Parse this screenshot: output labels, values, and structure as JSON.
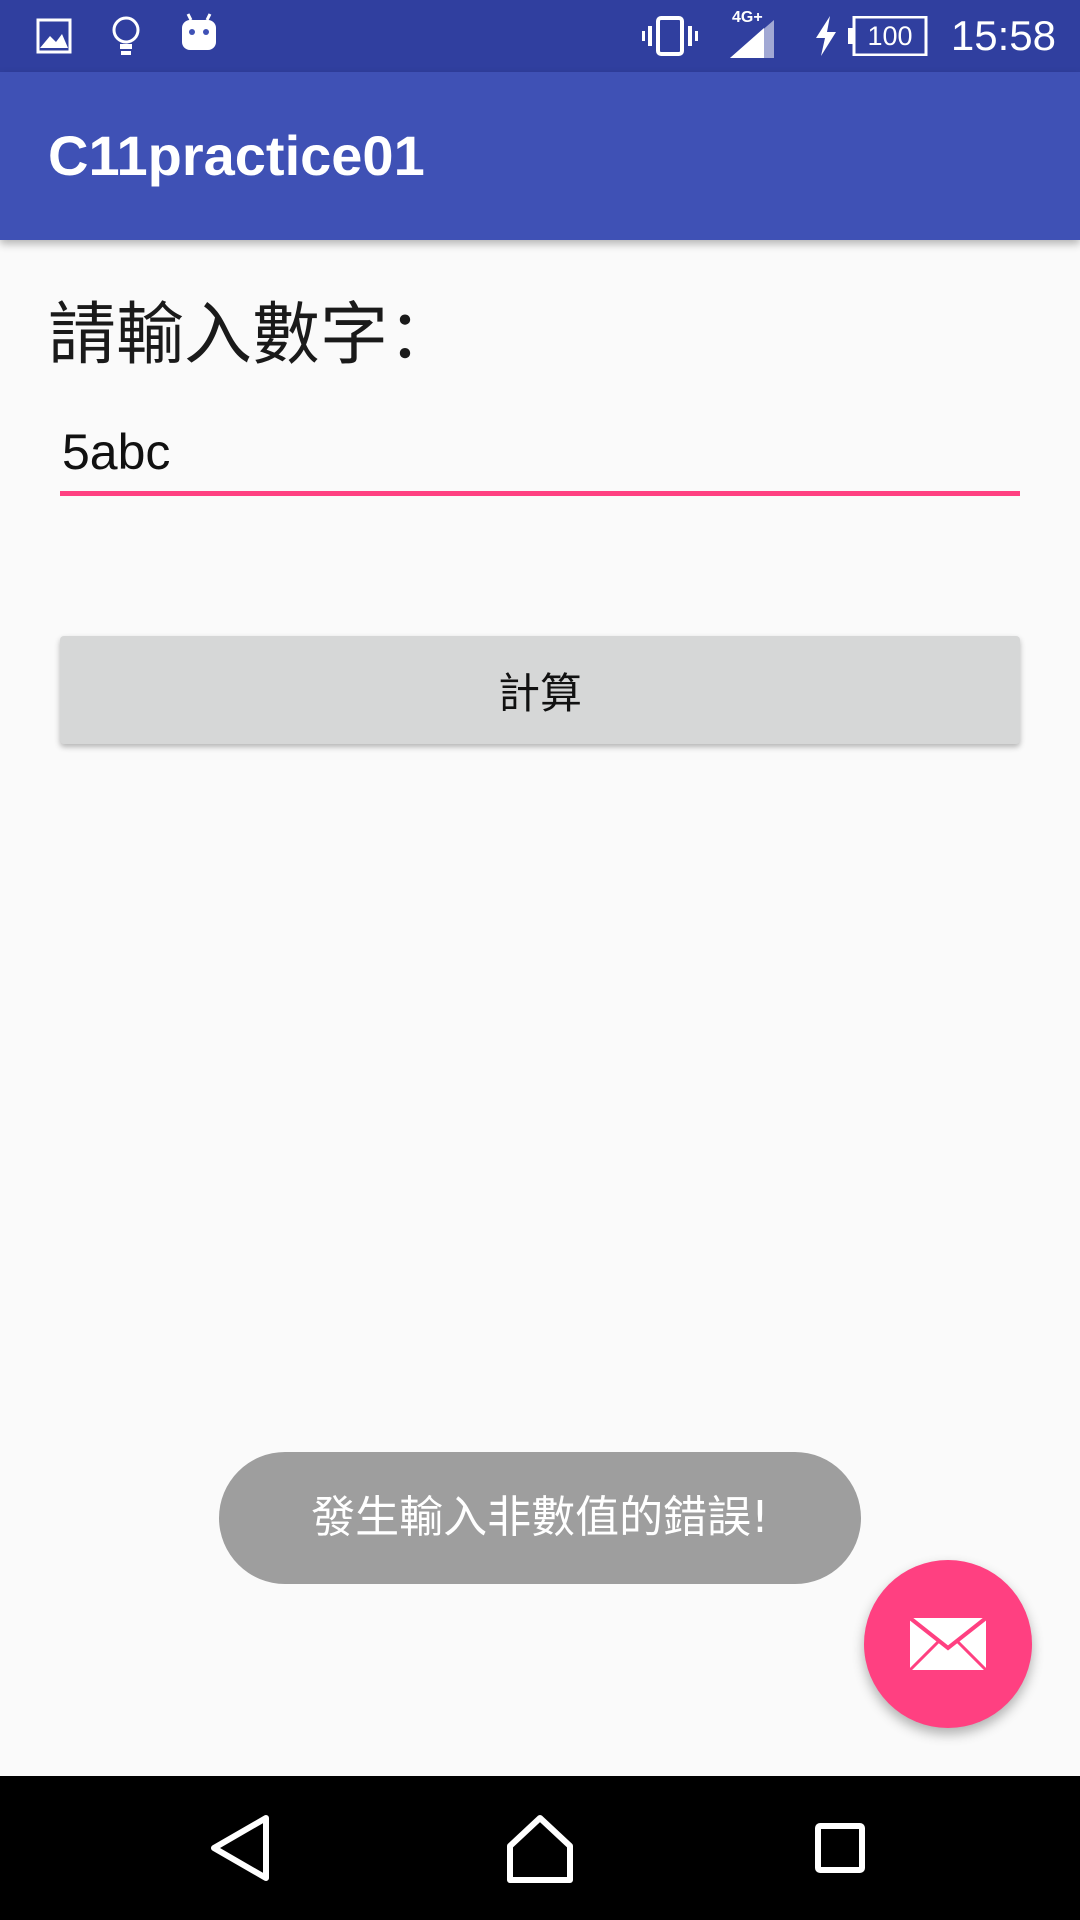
{
  "status_bar": {
    "time": "15:58",
    "battery_level": "100",
    "network_type": "4G+",
    "icons": [
      "image-icon",
      "lightbulb-icon",
      "android-icon",
      "vibrate-icon",
      "signal-icon",
      "charging-icon",
      "battery-icon"
    ]
  },
  "app_bar": {
    "title": "C11practice01"
  },
  "main": {
    "prompt_label": "請輸入數字：",
    "input_value": "5abc",
    "calc_button_label": "計算"
  },
  "toast": {
    "message": "發生輸入非數值的錯誤!"
  },
  "fab": {
    "icon": "email-icon"
  },
  "nav_bar": {
    "icons": [
      "back-icon",
      "home-icon",
      "recents-icon"
    ]
  },
  "colors": {
    "primary": "#3f51b5",
    "primary_dark": "#303f9f",
    "accent": "#ff4081",
    "toast_bg": "#9e9e9e",
    "button_bg": "#d6d7d7"
  }
}
